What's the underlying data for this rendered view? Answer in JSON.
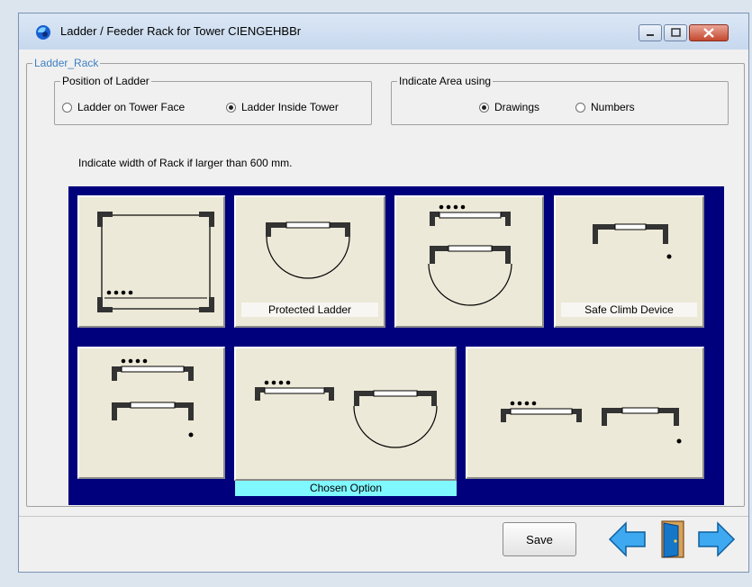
{
  "window": {
    "title": "Ladder / Feeder Rack for Tower CIENGEHBBr"
  },
  "rack_group": {
    "legend": "Ladder_Rack",
    "position": {
      "legend": "Position of Ladder",
      "options": [
        {
          "label": "Ladder on Tower Face",
          "selected": false
        },
        {
          "label": "Ladder Inside Tower",
          "selected": true
        }
      ]
    },
    "area": {
      "legend": "Indicate Area using",
      "options": [
        {
          "label": "Drawings",
          "selected": true
        },
        {
          "label": "Numbers",
          "selected": false
        }
      ]
    },
    "hint": "Indicate width of Rack if larger than 600 mm."
  },
  "options": [
    {
      "icon": "ladder-inside-square-rack-icon",
      "label": ""
    },
    {
      "icon": "protected-ladder-icon",
      "label": "Protected Ladder"
    },
    {
      "icon": "ladder-with-protected-rack-icon",
      "label": ""
    },
    {
      "icon": "safe-climb-device-icon",
      "label": "Safe Climb Device"
    },
    {
      "icon": "ladder-with-safe-climb-stack-icon",
      "label": ""
    },
    {
      "icon": "ladder-and-protected-rack-icon",
      "label": "",
      "chosen": true
    },
    {
      "icon": "ladder-and-safe-climb-icon",
      "label": ""
    }
  ],
  "chosen_label": "Chosen Option",
  "footer": {
    "save_label": "Save"
  },
  "colors": {
    "panel_background": "#00007d",
    "chosen_highlight": "#7ff8ff",
    "tile": "#ece9d8",
    "nav_arrow": "#3ea8f0"
  }
}
